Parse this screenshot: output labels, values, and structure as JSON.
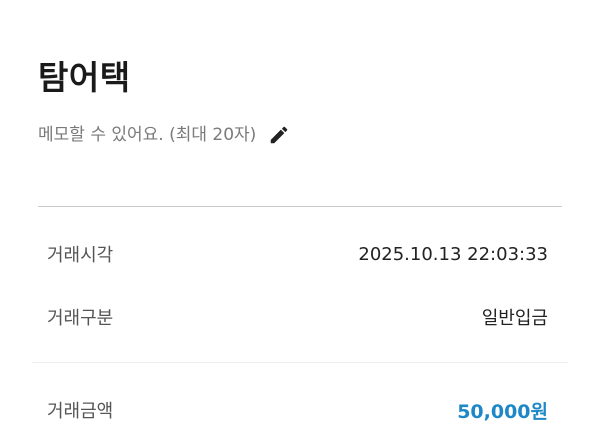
{
  "header": {
    "title": "탐어택",
    "memo_placeholder": "메모할 수 있어요. (최대 20자)"
  },
  "details": {
    "time_label": "거래시각",
    "time_value": "2025.10.13 22:03:33",
    "type_label": "거래구분",
    "type_value": "일반입금",
    "amount_label": "거래금액",
    "amount_value": "50,000원"
  },
  "colors": {
    "amount_accent": "#1e88c7"
  },
  "icons": {
    "memo_edit": "pencil-icon"
  }
}
